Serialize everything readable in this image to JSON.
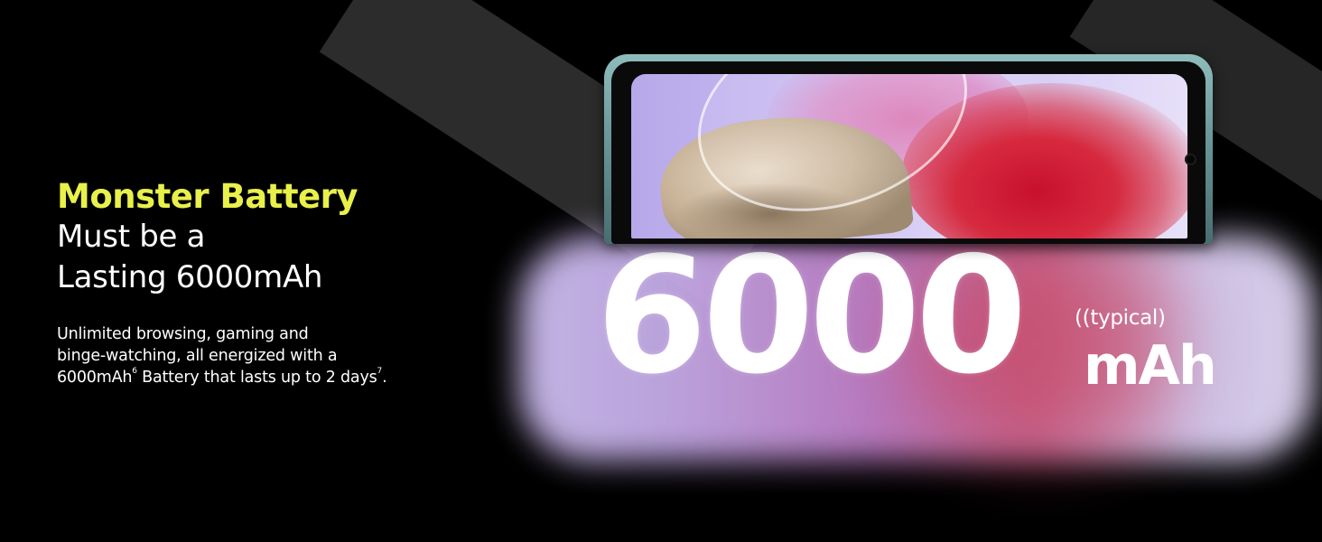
{
  "colors": {
    "accent": "#e8f04a",
    "text": "#ffffff",
    "background": "#000000"
  },
  "headline": {
    "accent": "Monster Battery",
    "line1": "Must be a",
    "line2": "Lasting 6000mAh"
  },
  "body": {
    "line1": "Unlimited browsing, gaming and",
    "line2": "binge-watching, all energized with a",
    "line3_prefix": "6000mAh",
    "footnote_battery": "6",
    "line3_middle": " Battery that lasts up to 2 days",
    "footnote_days": "7",
    "line3_suffix": "."
  },
  "battery_graphic": {
    "number": "6000",
    "qualifier": "((typical)",
    "unit": "mAh"
  }
}
